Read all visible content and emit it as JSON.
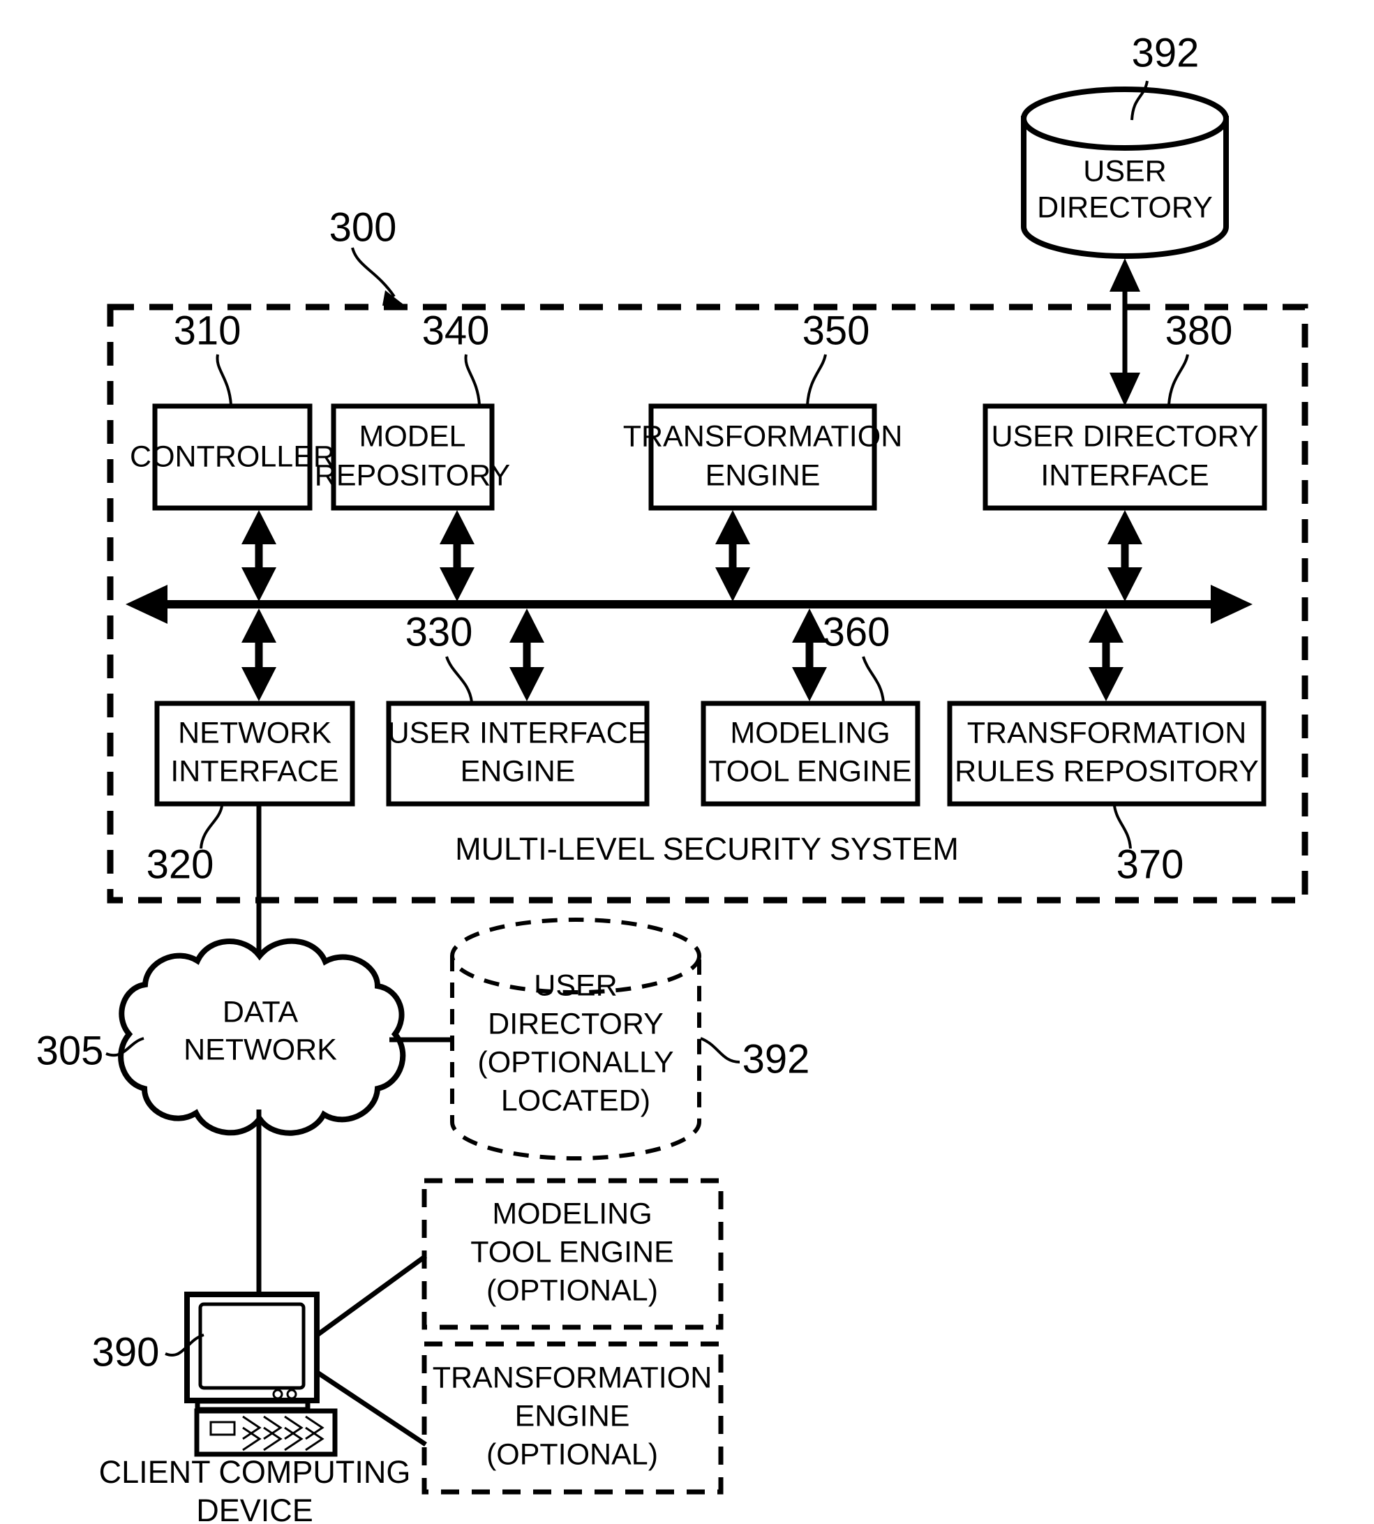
{
  "figure": {
    "title": "Multi-Level Security System Architecture Diagram"
  },
  "system": {
    "boundary_ref": "300",
    "boundary_label": "MULTI-LEVEL SECURITY SYSTEM"
  },
  "top_components": [
    {
      "ref": "310",
      "line1": "CONTROLLER",
      "line2": ""
    },
    {
      "ref": "340",
      "line1": "MODEL",
      "line2": "REPOSITORY"
    },
    {
      "ref": "350",
      "line1": "TRANSFORMATION",
      "line2": "ENGINE"
    },
    {
      "ref": "380",
      "line1": "USER DIRECTORY",
      "line2": "INTERFACE"
    }
  ],
  "bottom_components": [
    {
      "ref": "320",
      "line1": "NETWORK",
      "line2": "INTERFACE"
    },
    {
      "ref": "330",
      "line1": "USER INTERFACE",
      "line2": "ENGINE"
    },
    {
      "ref": "360",
      "line1": "MODELING",
      "line2": "TOOL ENGINE"
    },
    {
      "ref": "370",
      "line1": "TRANSFORMATION",
      "line2": "RULES REPOSITORY"
    }
  ],
  "external": {
    "user_directory_top": {
      "ref": "392",
      "line1": "USER",
      "line2": "DIRECTORY"
    },
    "data_network": {
      "ref": "305",
      "line1": "DATA",
      "line2": "NETWORK"
    },
    "user_directory_optional": {
      "ref": "392",
      "line1": "USER",
      "line2": "DIRECTORY",
      "line3": "(OPTIONALLY",
      "line4": "LOCATED)"
    },
    "client_device": {
      "ref": "390",
      "line1": "CLIENT COMPUTING",
      "line2": "DEVICE"
    },
    "optional_boxes": [
      {
        "line1": "MODELING",
        "line2": "TOOL ENGINE",
        "line3": "(OPTIONAL)"
      },
      {
        "line1": "TRANSFORMATION",
        "line2": "ENGINE",
        "line3": "(OPTIONAL)"
      }
    ]
  },
  "colors": {
    "ink": "#000000",
    "paper": "#ffffff"
  }
}
